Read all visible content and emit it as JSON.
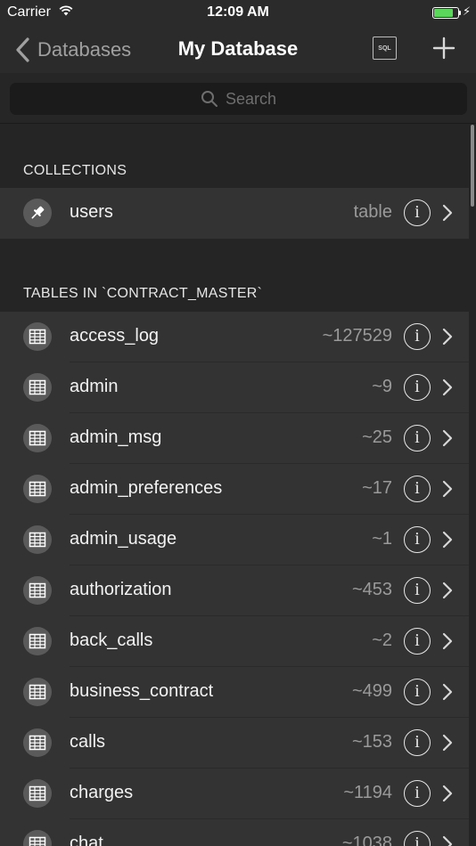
{
  "status_bar": {
    "carrier": "Carrier",
    "time": "12:09 AM",
    "battery_level": 0.85,
    "battery_color": "#5bd75b"
  },
  "nav": {
    "back_label": "Databases",
    "title": "My Database",
    "sql_label": "SQL"
  },
  "search": {
    "placeholder": "Search"
  },
  "collections": {
    "header": "COLLECTIONS",
    "items": [
      {
        "name": "users",
        "value": "table",
        "icon": "pin-icon"
      }
    ]
  },
  "tables": {
    "header": "TABLES IN `CONTRACT_MASTER`",
    "items": [
      {
        "name": "access_log",
        "value": "~127529"
      },
      {
        "name": "admin",
        "value": "~9"
      },
      {
        "name": "admin_msg",
        "value": "~25"
      },
      {
        "name": "admin_preferences",
        "value": "~17"
      },
      {
        "name": "admin_usage",
        "value": "~1"
      },
      {
        "name": "authorization",
        "value": "~453"
      },
      {
        "name": "back_calls",
        "value": "~2"
      },
      {
        "name": "business_contract",
        "value": "~499"
      },
      {
        "name": "calls",
        "value": "~153"
      },
      {
        "name": "charges",
        "value": "~1194"
      },
      {
        "name": "chat",
        "value": "~1038"
      }
    ]
  },
  "colors": {
    "background": "#252525",
    "row": "#333333",
    "bar": "#2b2b2b",
    "muted_text": "#9a9a9a"
  }
}
